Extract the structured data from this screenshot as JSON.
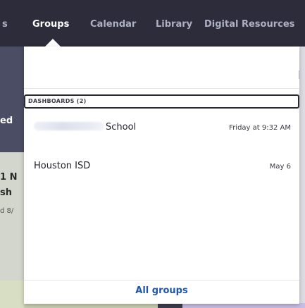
{
  "nav": {
    "items": [
      {
        "label": "s"
      },
      {
        "label": "Groups"
      },
      {
        "label": "Calendar"
      },
      {
        "label": "Library"
      },
      {
        "label": "Digital Resources"
      }
    ]
  },
  "background": {
    "text1": "ed",
    "text2": "1 N",
    "text3": "sh",
    "text4": "d 8/"
  },
  "dropdown": {
    "section_header": "DASHBOARDS (2)",
    "items": [
      {
        "name": "School",
        "time": "Friday at 9:32 AM"
      },
      {
        "name": "Houston ISD",
        "time": "May 6"
      }
    ],
    "footer_link": "All groups"
  },
  "colors": {
    "nav_bg": "#2c2c3a",
    "nav_active": "#ffffff",
    "nav_inactive": "#aeb0c4",
    "link": "#2157a8"
  }
}
